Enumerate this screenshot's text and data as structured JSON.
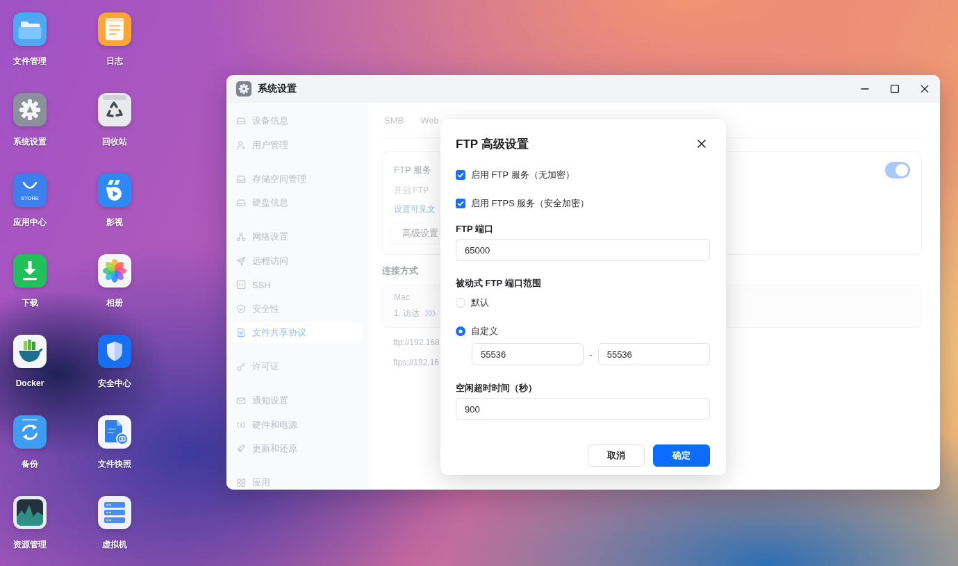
{
  "desktop": {
    "icons": [
      {
        "label": "文件管理",
        "kind": "folder"
      },
      {
        "label": "日志",
        "kind": "notes"
      },
      {
        "label": "系统设置",
        "kind": "settings"
      },
      {
        "label": "回收站",
        "kind": "recycle"
      },
      {
        "label": "应用中心",
        "kind": "store",
        "text": "STORE"
      },
      {
        "label": "影视",
        "kind": "video"
      },
      {
        "label": "下载",
        "kind": "download"
      },
      {
        "label": "相册",
        "kind": "photos"
      },
      {
        "label": "Docker",
        "kind": "docker"
      },
      {
        "label": "安全中心",
        "kind": "security"
      },
      {
        "label": "备份",
        "kind": "backup"
      },
      {
        "label": "文件快照",
        "kind": "snapshot"
      },
      {
        "label": "资源管理",
        "kind": "monitor"
      },
      {
        "label": "虚拟机",
        "kind": "vm"
      }
    ]
  },
  "settings_window": {
    "title": "系统设置",
    "sidebar": {
      "groups": [
        {
          "items": [
            {
              "label": "设备信息",
              "kind": "device",
              "selected": false
            },
            {
              "label": "用户管理",
              "kind": "users",
              "selected": false
            }
          ]
        },
        {
          "items": [
            {
              "label": "存储空间管理",
              "kind": "storage",
              "selected": false
            },
            {
              "label": "硬盘信息",
              "kind": "disk",
              "selected": false
            }
          ]
        },
        {
          "items": [
            {
              "label": "网络设置",
              "kind": "network",
              "selected": false
            },
            {
              "label": "远程访问",
              "kind": "remote",
              "selected": false
            },
            {
              "label": "SSH",
              "kind": "ssh",
              "selected": false
            },
            {
              "label": "安全性",
              "kind": "security",
              "selected": false
            },
            {
              "label": "文件共享协议",
              "kind": "sharing",
              "selected": true
            }
          ]
        },
        {
          "items": [
            {
              "label": "许可证",
              "kind": "license",
              "selected": false
            }
          ]
        },
        {
          "items": [
            {
              "label": "通知设置",
              "kind": "notify",
              "selected": false
            },
            {
              "label": "硬件和电源",
              "kind": "power",
              "selected": false
            },
            {
              "label": "更新和还原",
              "kind": "update",
              "selected": false
            }
          ]
        },
        {
          "items": [
            {
              "label": "应用",
              "kind": "apps",
              "selected": false
            }
          ]
        }
      ]
    },
    "tabs": [
      {
        "label": "SMB",
        "selected": false
      },
      {
        "label": "Web",
        "selected": false
      }
    ],
    "ftp_service": {
      "title": "FTP 服务",
      "description": "开启 FTP",
      "link": "设置可见文",
      "on": true,
      "advanced_button": "高级设置"
    },
    "connection": {
      "heading": "连接方式",
      "platform": "Mac",
      "step": "1. 访达",
      "urls": [
        "ftp://192.168",
        "ftps://192.16"
      ]
    }
  },
  "dialog": {
    "title": "FTP 高级设置",
    "options": [
      {
        "label": "启用 FTP 服务（无加密）",
        "checked": true
      },
      {
        "label": "启用 FTPS 服务（安全加密）",
        "checked": true
      }
    ],
    "port": {
      "label": "FTP 端口",
      "value": "65000"
    },
    "passive_range": {
      "label": "被动式 FTP 端口范围",
      "choices": [
        {
          "label": "默认",
          "selected": false
        },
        {
          "label": "自定义",
          "selected": true
        }
      ],
      "from": "55536",
      "separator": "-",
      "to": "55536"
    },
    "idle_timeout": {
      "label": "空闲超时时间（秒）",
      "value": "900"
    },
    "buttons": [
      {
        "label": "取消",
        "kind": "secondary"
      },
      {
        "label": "确定",
        "kind": "primary"
      }
    ]
  }
}
